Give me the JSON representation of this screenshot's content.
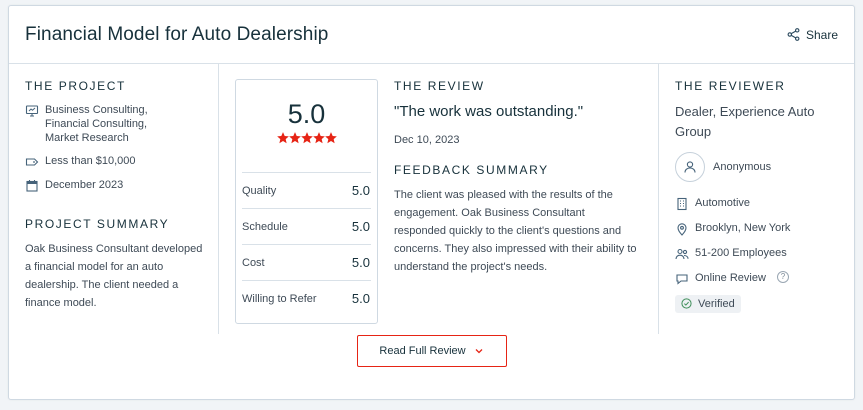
{
  "header": {
    "title": "Financial Model for Auto Dealership",
    "share_label": "Share"
  },
  "project": {
    "section_title": "THE PROJECT",
    "services": [
      "Business Consulting,",
      "Financial Consulting,",
      "Market Research"
    ],
    "budget": "Less than $10,000",
    "date": "December 2023",
    "summary_title": "PROJECT SUMMARY",
    "summary": "Oak Business Consultant developed a financial model for an auto dealership. The client needed a finance model."
  },
  "scores": {
    "overall": "5.0",
    "stars": 5,
    "rows": [
      {
        "label": "Quality",
        "value": "5.0"
      },
      {
        "label": "Schedule",
        "value": "5.0"
      },
      {
        "label": "Cost",
        "value": "5.0"
      },
      {
        "label": "Willing to Refer",
        "value": "5.0"
      }
    ]
  },
  "review": {
    "section_title": "THE REVIEW",
    "quote": "\"The work was outstanding.\"",
    "date": "Dec 10, 2023",
    "feedback_title": "FEEDBACK SUMMARY",
    "feedback": "The client was pleased with the results of the engagement.  Oak Business Consultant responded quickly to the client's questions and concerns. They also impressed with their ability to understand the project's needs."
  },
  "reviewer": {
    "section_title": "THE REVIEWER",
    "company": "Dealer, Experience Auto Group",
    "name": "Anonymous",
    "industry": "Automotive",
    "location": "Brooklyn, New York",
    "size": "51-200 Employees",
    "review_type": "Online Review",
    "help_mark": "?",
    "verified": "Verified"
  },
  "footer": {
    "button_label": "Read Full Review"
  },
  "colors": {
    "star": "#e62415",
    "accent_border": "#e62415",
    "text_dark": "#17313b"
  }
}
